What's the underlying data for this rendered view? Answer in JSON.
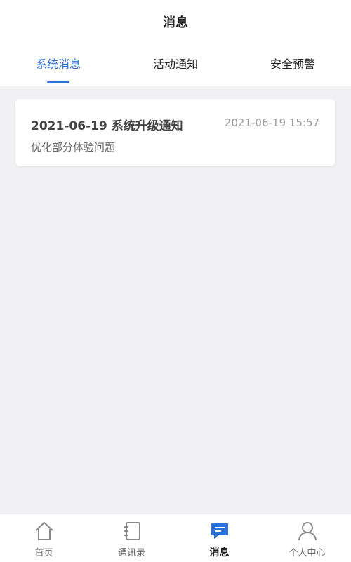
{
  "header": {
    "title": "消息",
    "tabs": [
      {
        "label": "系统消息",
        "active": true
      },
      {
        "label": "活动通知",
        "active": false
      },
      {
        "label": "安全预警",
        "active": false
      }
    ]
  },
  "messages": [
    {
      "title": "2021-06-19 系统升级通知",
      "time": "2021-06-19 15:57",
      "desc": "优化部分体验问题"
    }
  ],
  "bottom_nav": {
    "items": [
      {
        "label": "首页",
        "icon": "home-icon",
        "active": false
      },
      {
        "label": "通讯录",
        "icon": "contacts-icon",
        "active": false
      },
      {
        "label": "消息",
        "icon": "message-icon",
        "active": true
      },
      {
        "label": "个人中心",
        "icon": "person-icon",
        "active": false
      }
    ]
  },
  "colors": {
    "accent": "#2e6fdb",
    "background": "#f1f1f3"
  }
}
